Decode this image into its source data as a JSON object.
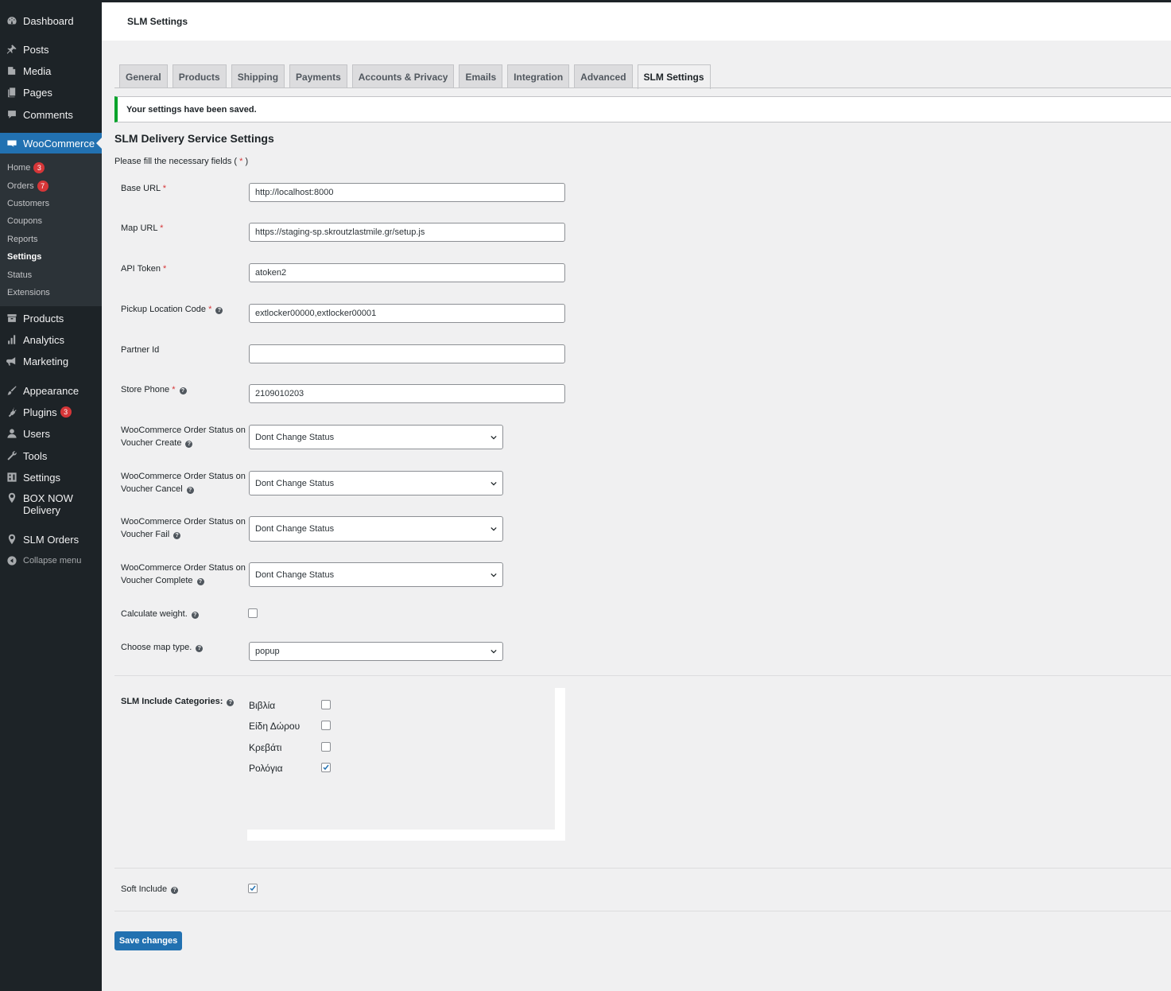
{
  "page_title": "SLM Settings",
  "sidebar": {
    "dashboard": "Dashboard",
    "posts": "Posts",
    "media": "Media",
    "pages": "Pages",
    "comments": "Comments",
    "woocommerce": "WooCommerce",
    "submenu": {
      "home": "Home",
      "home_badge": "3",
      "orders": "Orders",
      "orders_badge": "7",
      "customers": "Customers",
      "coupons": "Coupons",
      "reports": "Reports",
      "settings": "Settings",
      "status": "Status",
      "extensions": "Extensions"
    },
    "products": "Products",
    "analytics": "Analytics",
    "marketing": "Marketing",
    "appearance": "Appearance",
    "plugins": "Plugins",
    "plugins_badge": "3",
    "users": "Users",
    "tools": "Tools",
    "settings": "Settings",
    "boxnow_line1": "BOX NOW",
    "boxnow_line2": "Delivery",
    "slm_orders": "SLM Orders",
    "collapse": "Collapse menu"
  },
  "tabs": [
    "General",
    "Products",
    "Shipping",
    "Payments",
    "Accounts & Privacy",
    "Emails",
    "Integration",
    "Advanced",
    "SLM Settings"
  ],
  "notice": "Your settings have been saved.",
  "section_title": "SLM Delivery Service Settings",
  "section_desc_prefix": "Please fill the necessary fields ( ",
  "section_desc_req": "*",
  "section_desc_suffix": " )",
  "fields": {
    "base_url": {
      "label": "Base URL",
      "value": "http://localhost:8000"
    },
    "map_url": {
      "label": "Map URL",
      "value": "https://staging-sp.skroutzlastmile.gr/setup.js"
    },
    "api_token": {
      "label": "API Token",
      "value": "atoken2"
    },
    "pickup_code": {
      "label": "Pickup Location Code",
      "value": "extlocker00000,extlocker00001"
    },
    "partner_id": {
      "label": "Partner Id",
      "value": ""
    },
    "store_phone": {
      "label": "Store Phone",
      "value": "2109010203"
    },
    "status_create": {
      "label_line1": "WooCommerce Order Status on",
      "label_line2": "Voucher Create",
      "value": "Dont Change Status"
    },
    "status_cancel": {
      "label_line1": "WooCommerce Order Status on",
      "label_line2": "Voucher Cancel",
      "value": "Dont Change Status"
    },
    "status_fail": {
      "label_line1": "WooCommerce Order Status on",
      "label_line2": "Voucher Fail",
      "value": "Dont Change Status"
    },
    "status_complete": {
      "label_line1": "WooCommerce Order Status on",
      "label_line2": "Voucher Complete",
      "value": "Dont Change Status"
    },
    "calc_weight": {
      "label": "Calculate weight.",
      "checked": false
    },
    "map_type": {
      "label": "Choose map type.",
      "value": "popup"
    },
    "include_categories": {
      "label": "SLM Include Categories:",
      "items": [
        {
          "name": "Βιβλία",
          "checked": false
        },
        {
          "name": "Είδη Δώρου",
          "checked": false
        },
        {
          "name": "Κρεβάτι",
          "checked": false
        },
        {
          "name": "Ρολόγια",
          "checked": true
        }
      ]
    },
    "soft_include": {
      "label": "Soft Include",
      "checked": true
    }
  },
  "required_mark": "*",
  "help_glyph": "?",
  "save_button": "Save changes",
  "colors": {
    "accent": "#2271b1",
    "sidebar": "#1d2327",
    "success": "#00a32a",
    "required": "#d63638"
  }
}
